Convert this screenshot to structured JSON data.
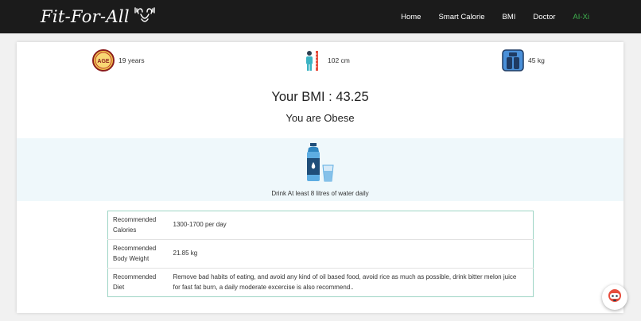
{
  "navbar": {
    "brand": "Fit-For-All",
    "links": [
      {
        "label": "Home"
      },
      {
        "label": "Smart Calorie"
      },
      {
        "label": "BMI"
      },
      {
        "label": "Doctor"
      },
      {
        "label": "AI-Xi"
      }
    ],
    "active_color": "#3fb34f"
  },
  "stats": {
    "age": {
      "icon": "age-badge-icon",
      "icon_text": "AGE",
      "value": "19 years"
    },
    "height": {
      "icon": "height-measure-icon",
      "value": "102 cm"
    },
    "weight": {
      "icon": "weighing-scale-icon",
      "value": "45 kg"
    }
  },
  "bmi": {
    "title": "Your BMI : 43.25",
    "status": "You are Obese"
  },
  "water": {
    "icon": "water-bottle-glass-icon",
    "caption": "Drink At least 8 litres of water daily"
  },
  "recommendations": [
    {
      "label": "Recommended Calories",
      "value": "1300-1700 per day"
    },
    {
      "label": "Recommended Body Weight",
      "value": "21.85 kg"
    },
    {
      "label": "Recommended Diet",
      "value": "Remove bad habits of eating, and avoid any kind of oil based food, avoid rice as much as possible, drink bitter melon juice for fast fat burn, a daily moderate excercise is also recommend.."
    }
  ],
  "chat": {
    "icon": "chatbot-icon"
  }
}
